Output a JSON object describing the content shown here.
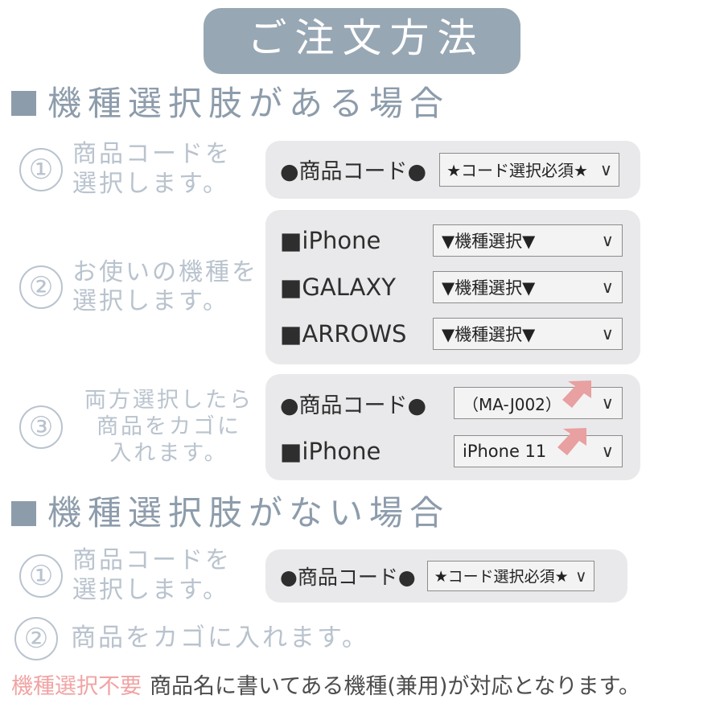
{
  "banner": {
    "title": "ご注文方法"
  },
  "colors": {
    "banner_bg": "#97a7b4",
    "heading": "#8d9cab",
    "step_text": "#b9c3ce",
    "panel_bg": "#e9e9eb",
    "select_border": "#8c8c8c",
    "arrow_pink": "#e8a0a0",
    "note_pink": "#f1a3a3",
    "note_dark": "#4c4c4c"
  },
  "section_with_options": {
    "heading": "機種選択肢がある場合",
    "bullet": "square-bullet-icon",
    "steps": [
      {
        "number": "①",
        "text": "商品コードを\n選択します。",
        "panel": {
          "rows": [
            {
              "label": "●商品コード●",
              "label_kind": "code",
              "select_value": "★コード選択必須★",
              "chevron": "∨",
              "arrow": false
            }
          ]
        }
      },
      {
        "number": "②",
        "text": "お使いの機種を\n選択します。",
        "panel": {
          "rows": [
            {
              "label": "■iPhone",
              "label_kind": "model",
              "select_value": "▼機種選択▼",
              "chevron": "∨",
              "arrow": false
            },
            {
              "label": "■GALAXY",
              "label_kind": "model",
              "select_value": "▼機種選択▼",
              "chevron": "∨",
              "arrow": false
            },
            {
              "label": "■ARROWS",
              "label_kind": "model",
              "select_value": "▼機種選択▼",
              "chevron": "∨",
              "arrow": false
            }
          ]
        }
      },
      {
        "number": "③",
        "text": "両方選択したら\n商品をカゴに\n入れます。",
        "panel": {
          "rows": [
            {
              "label": "●商品コード●",
              "label_kind": "code",
              "select_value": "（MA-J002）",
              "chevron": "∨",
              "arrow": true
            },
            {
              "label": "■iPhone",
              "label_kind": "model",
              "select_value": "iPhone 11",
              "chevron": "∨",
              "arrow": true
            }
          ]
        }
      }
    ]
  },
  "section_without_options": {
    "heading": "機種選択肢がない場合",
    "bullet": "square-bullet-icon",
    "steps": [
      {
        "number": "①",
        "text": "商品コードを\n選択します。",
        "panel": {
          "rows": [
            {
              "label": "●商品コード●",
              "label_kind": "code",
              "select_value": "★コード選択必須★",
              "chevron": "∨",
              "arrow": false
            }
          ]
        }
      },
      {
        "number": "②",
        "text": "商品をカゴに入れます。"
      }
    ],
    "note": {
      "highlight": "機種選択不要",
      "body": "商品名に書いてある機種(兼用)が対応となります。"
    }
  }
}
